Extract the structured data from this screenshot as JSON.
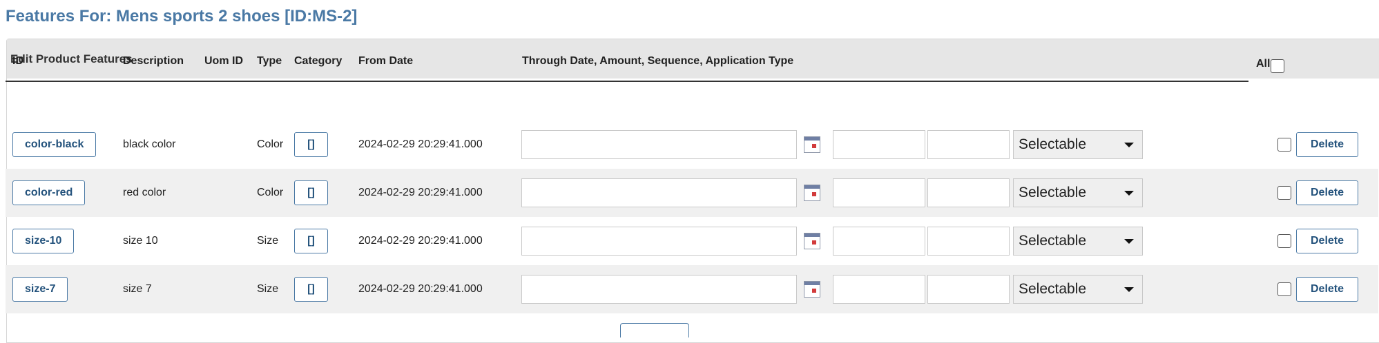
{
  "page": {
    "title": "Features For: Mens sports 2 shoes [ID:MS-2]"
  },
  "panel": {
    "title": "Edit Product Features"
  },
  "columns": {
    "id": "ID",
    "description": "Description",
    "uom_id": "Uom ID",
    "type": "Type",
    "category": "Category",
    "from_date": "From Date",
    "through": "Through Date, Amount, Sequence, Application Type",
    "all": "All"
  },
  "rows": [
    {
      "id": "color-black",
      "description": "black color",
      "type": "Color",
      "category": "[]",
      "from_date": "2024-02-29 20:29:41.000",
      "through_date": "",
      "amount": "",
      "sequence": "",
      "application_type": "Selectable",
      "delete": "Delete"
    },
    {
      "id": "color-red",
      "description": "red color",
      "type": "Color",
      "category": "[]",
      "from_date": "2024-02-29 20:29:41.000",
      "through_date": "",
      "amount": "",
      "sequence": "",
      "application_type": "Selectable",
      "delete": "Delete"
    },
    {
      "id": "size-10",
      "description": "size 10",
      "type": "Size",
      "category": "[]",
      "from_date": "2024-02-29 20:29:41.000",
      "through_date": "",
      "amount": "",
      "sequence": "",
      "application_type": "Selectable",
      "delete": "Delete"
    },
    {
      "id": "size-7",
      "description": "size 7",
      "type": "Size",
      "category": "[]",
      "from_date": "2024-02-29 20:29:41.000",
      "through_date": "",
      "amount": "",
      "sequence": "",
      "application_type": "Selectable",
      "delete": "Delete"
    }
  ],
  "icons": {
    "calendar": "calendar-icon",
    "dropdown": "chevron-down-icon"
  },
  "colors": {
    "title": "#4a79a5",
    "button_border": "#4a79a5",
    "header_bg": "#e6e6e6",
    "alt_row": "#f0f0f0"
  }
}
